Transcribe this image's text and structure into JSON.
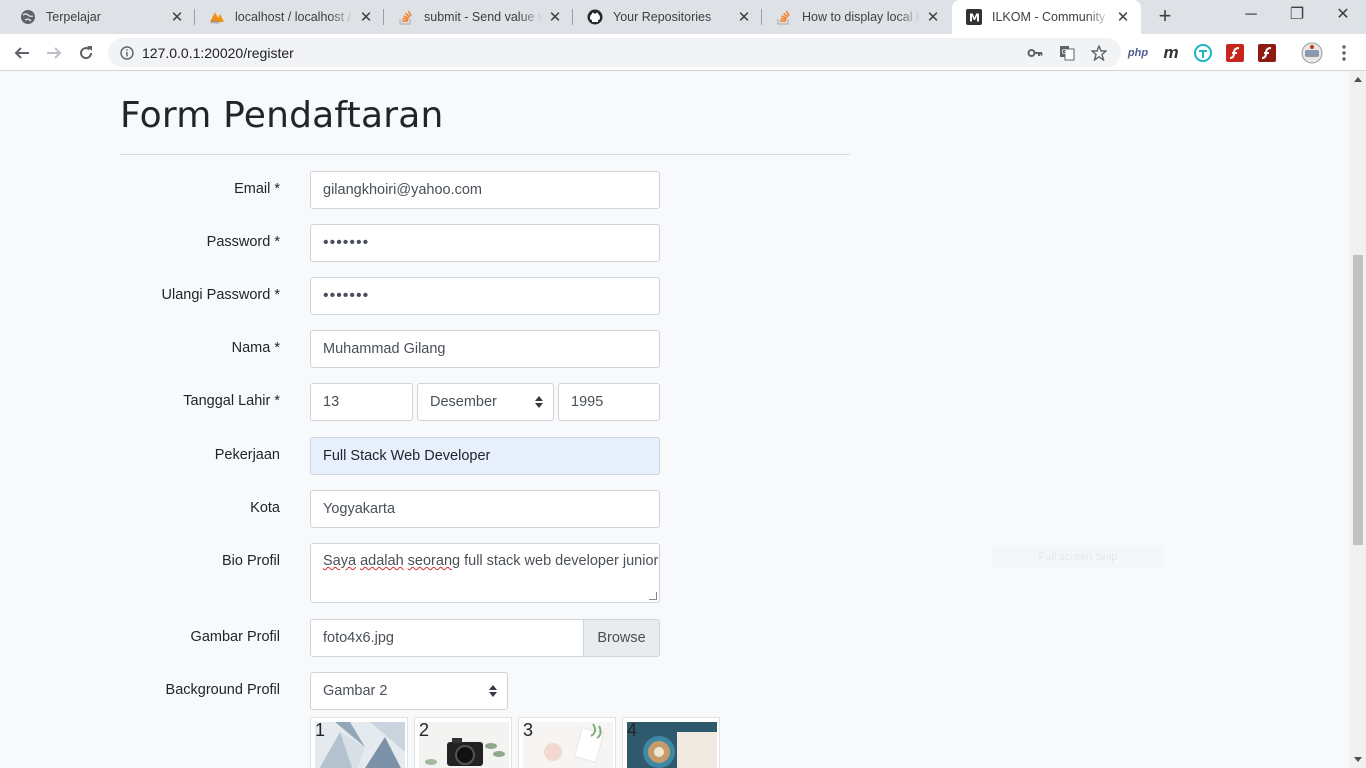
{
  "browser": {
    "tabs": [
      {
        "title": "Terpelajar",
        "favicon": "globe-icon"
      },
      {
        "title": "localhost / localhost / re",
        "favicon": "phpmyadmin-icon"
      },
      {
        "title": "submit - Send value wit",
        "favicon": "stackoverflow-icon"
      },
      {
        "title": "Your Repositories",
        "favicon": "github-icon"
      },
      {
        "title": "How to display local im",
        "favicon": "stackoverflow-icon"
      },
      {
        "title": "ILKOM - Community Bl",
        "favicon": "medium-icon",
        "active": true
      }
    ],
    "url": "127.0.0.1:20020/register",
    "extensions": [
      {
        "label": "php",
        "icon": "php-extension-icon"
      },
      {
        "label": "m",
        "icon": "m-extension-icon"
      },
      {
        "label": "",
        "icon": "teal-extension-icon"
      },
      {
        "label": "",
        "icon": "flash-extension-icon"
      },
      {
        "label": "",
        "icon": "flash-red-extension-icon"
      }
    ]
  },
  "form": {
    "title": "Form Pendaftaran",
    "email": {
      "label": "Email *",
      "value": "gilangkhoiri@yahoo.com"
    },
    "password": {
      "label": "Password *",
      "value": "•••••••"
    },
    "confirm_password": {
      "label": "Ulangi Password *",
      "value": "•••••••"
    },
    "name": {
      "label": "Nama *",
      "value": "Muhammad Gilang"
    },
    "birth_date": {
      "label": "Tanggal Lahir *",
      "day": "13",
      "month": "Desember",
      "year": "1995"
    },
    "job": {
      "label": "Pekerjaan",
      "value": "Full Stack Web Developer"
    },
    "city": {
      "label": "Kota",
      "value": "Yogyakarta"
    },
    "bio": {
      "label": "Bio Profil",
      "word1": "Saya",
      "word2": "adalah",
      "word3": "seorang",
      "rest": " full stack web developer junior"
    },
    "profile_image": {
      "label": "Gambar Profil",
      "value": "foto4x6.jpg",
      "browse_label": "Browse"
    },
    "background": {
      "label": "Background Profil",
      "selected": "Gambar 2"
    },
    "thumbnails": [
      "1",
      "2",
      "3",
      "4"
    ],
    "ghost_button": "Full screen Snip"
  },
  "colors": {
    "page_bg": "#f8f9fb",
    "autofill_bg": "#e8f0fe",
    "border": "#ced4da"
  }
}
